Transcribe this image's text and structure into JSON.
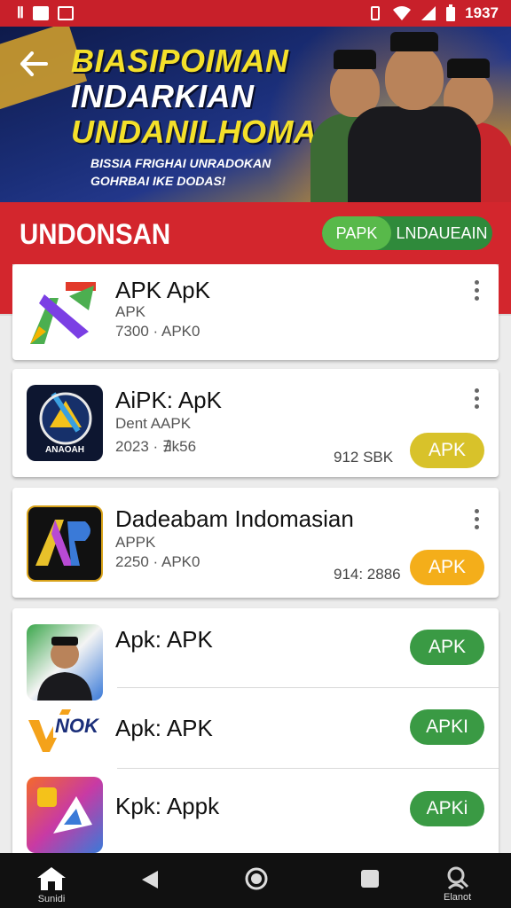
{
  "status_bar": {
    "left_glyph": " Ⅱ",
    "time": "1937"
  },
  "banner": {
    "title_lines": [
      "BIASIPOIMAN",
      "INDARKIAN",
      "UNDANILHOMA"
    ],
    "subtitle_lines": [
      "BISSIA FRIGHAI UNRADOKAN",
      "GOHRBAI IKE DODAS!"
    ]
  },
  "header": {
    "title": "UNDONSAN",
    "toggle": {
      "on_label": "PAPK",
      "off_label": "LNDAUEAIN"
    }
  },
  "apps": [
    {
      "name": "APK ApK",
      "line1": "APK",
      "line2": "7300 · APK0",
      "icon_label": ""
    },
    {
      "name": "AiPK: ApK",
      "line1": "Dent AAPK",
      "line2": "2023 · ∄k56",
      "size": "912 SBK",
      "button": "APK",
      "icon_label": "ANAOAH"
    },
    {
      "name": "Dadeabam Indomasian",
      "line1": "APPK",
      "line2": "2250 · APK0",
      "size": "914: 2886",
      "button": "APK",
      "icon_label": ""
    },
    {
      "name": "Apk: APK",
      "button": "APK"
    },
    {
      "name": "Apk: APK",
      "button": "APKI",
      "icon_label": "NOK"
    },
    {
      "name": "Kpk: Appk",
      "button": "APKi"
    }
  ],
  "nav": {
    "home_label": "Sunidi",
    "profile_label": "Elanot"
  },
  "colors": {
    "brand_red": "#d3262d",
    "green": "#3a9a44",
    "yellow": "#d8c22a",
    "orange": "#f4ae1a"
  }
}
